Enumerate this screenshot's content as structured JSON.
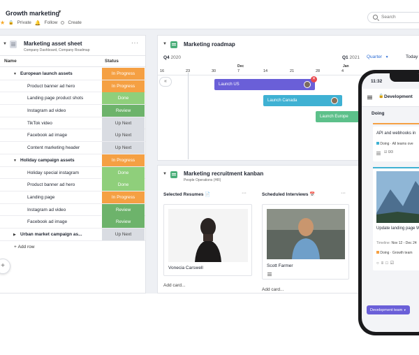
{
  "workspace": {
    "title": "Growth marketing",
    "private": "Private",
    "follow": "Follow",
    "create": "Create"
  },
  "search": {
    "placeholder": "Search"
  },
  "asset_sheet": {
    "title": "Marketing asset sheet",
    "subtitle": "Company Dashboard, Company Roadmap",
    "col_name": "Name",
    "col_status": "Status",
    "rows": [
      {
        "name": "European launch assets",
        "status": "In Progress",
        "group": true,
        "color": "#f5a043"
      },
      {
        "name": "Product banner ad hero",
        "status": "In Progress",
        "color": "#f5a043"
      },
      {
        "name": "Landing page product shots",
        "status": "Done",
        "color": "#8fcf7b"
      },
      {
        "name": "Instagram ad video",
        "status": "Review",
        "color": "#6db36b"
      },
      {
        "name": "TikTok video",
        "status": "Up Next",
        "color": "#d9dce2"
      },
      {
        "name": "Facebook ad image",
        "status": "Up Next",
        "color": "#d9dce2"
      },
      {
        "name": "Content marketing header",
        "status": "Up Next",
        "color": "#d9dce2"
      },
      {
        "name": "Holiday campaign assets",
        "status": "In Progress",
        "group": true,
        "color": "#f5a043"
      },
      {
        "name": "Holiday special instagram",
        "status": "Done",
        "color": "#8fcf7b"
      },
      {
        "name": "Product banner ad hero",
        "status": "Done",
        "color": "#8fcf7b"
      },
      {
        "name": "Landing page",
        "status": "In Progress",
        "color": "#f5a043"
      },
      {
        "name": "Instagram ad video",
        "status": "Review",
        "color": "#6db36b"
      },
      {
        "name": "Facebook ad image",
        "status": "Review",
        "color": "#6db36b"
      },
      {
        "name": "Urban market campaign as...",
        "status": "Up Next",
        "group": true,
        "collapsed": true,
        "color": "#d9dce2"
      }
    ],
    "add_row": "Add row"
  },
  "roadmap": {
    "title": "Marketing roadmap",
    "q4": "Q4",
    "q4_year": "2020",
    "q1": "Q1",
    "q1_year": "2021",
    "scale": "Quarter",
    "today": "Today",
    "month_dec": "Dec",
    "month_jan": "Jan",
    "ticks": [
      "16",
      "23",
      "30",
      "7",
      "14",
      "21",
      "28",
      "4"
    ],
    "bars": [
      {
        "label": "Launch US",
        "color": "#6a5fd8"
      },
      {
        "label": "Launch Canada",
        "color": "#3fb1d3"
      },
      {
        "label": "Launch Europe",
        "color": "#5cc08a"
      }
    ]
  },
  "kanban": {
    "title": "Marketing recruitment kanban",
    "subtitle": "People Operations (HR)",
    "columns": [
      {
        "title": "Selected Resumes 📄",
        "card_name": "Vonecia Carswell"
      },
      {
        "title": "Scheduled Interviews 📅",
        "card_name": "Scott Farmer"
      }
    ],
    "add_card": "Add card..."
  },
  "phone": {
    "time": "11:32",
    "board_title": "Development",
    "column": "Doing",
    "card1_title": "API and webhooks in",
    "card1_chip": "Doing · All teams ove",
    "card1_count": "0/3",
    "card2_title": "Update landing page Word)",
    "card2_timeline_label": "Timeline:",
    "card2_timeline": "Nov 12 - Dec 24",
    "card2_chip": "Doing · Growth team",
    "team_button": "Development team"
  }
}
